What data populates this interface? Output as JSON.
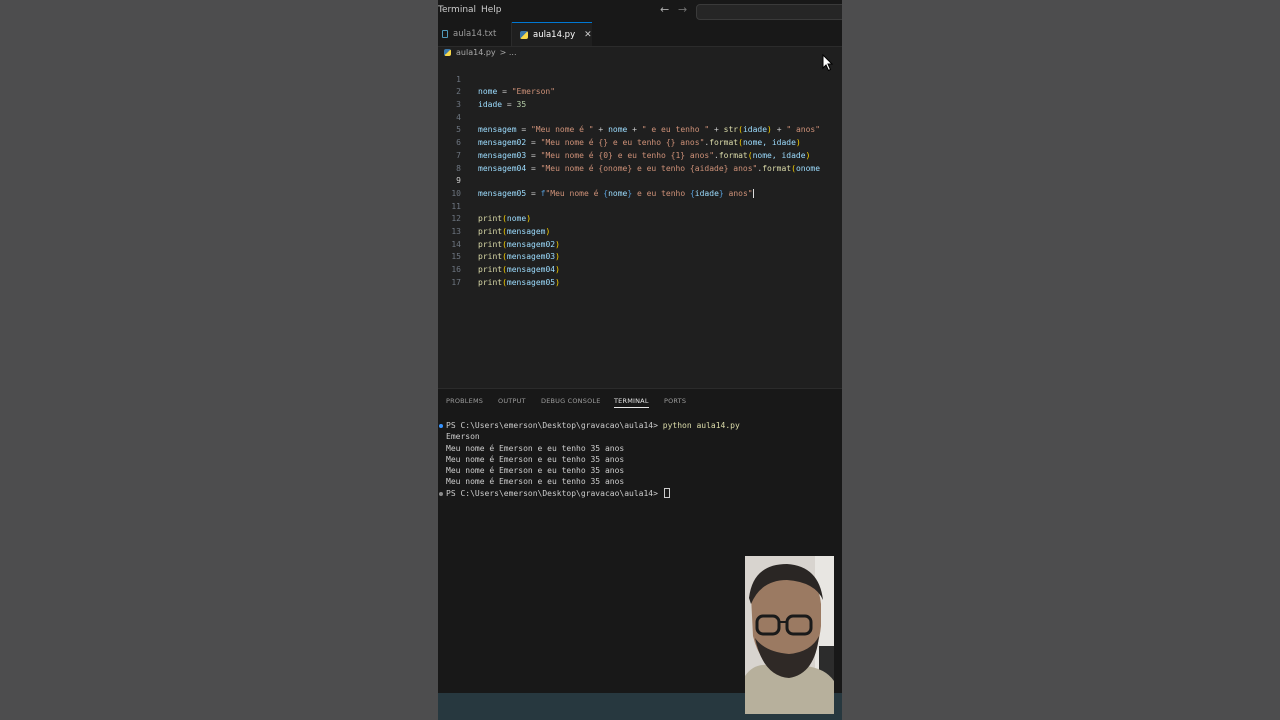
{
  "menu": {
    "terminal": "Terminal",
    "help": "Help"
  },
  "tabs": [
    {
      "label": "aula14.txt"
    },
    {
      "label": "aula14.py",
      "close": "✕"
    }
  ],
  "breadcrumb": {
    "file": "aula14.py",
    "sep": "> ..."
  },
  "editor": {
    "active_line": 9,
    "line_numbers": [
      "1",
      "2",
      "3",
      "4",
      "5",
      "6",
      "7",
      "8",
      "9",
      "10",
      "11",
      "12",
      "13",
      "14",
      "15",
      "16",
      "17"
    ],
    "lines": {
      "l1": {
        "var": "nome",
        "op": " = ",
        "str": "\"Emerson\""
      },
      "l2": {
        "var": "idade",
        "op": " = ",
        "num": "35"
      },
      "l4": {
        "var": "mensagem",
        "op": " = ",
        "s1": "\"Meu nome é \"",
        "p1": " + ",
        "v1": "nome",
        "p2": " + ",
        "s2": "\" e eu tenho \"",
        "p3": " + ",
        "fn": "str",
        "paren_open": "(",
        "v2": "idade",
        "paren_close": ")",
        "p4": " + ",
        "s3": "\" anos\""
      },
      "l5": {
        "var": "mensagem02",
        "op": " = ",
        "str": "\"Meu nome é {} e eu tenho {} anos\"",
        "dot": ".",
        "fn": "format",
        "paren_open": "(",
        "args": "nome, idade",
        "paren_close": ")"
      },
      "l6": {
        "var": "mensagem03",
        "op": " = ",
        "str": "\"Meu nome é {0} e eu tenho {1} anos\"",
        "dot": ".",
        "fn": "format",
        "paren_open": "(",
        "args": "nome, idade",
        "paren_close": ")"
      },
      "l7": {
        "var": "mensagem04",
        "op": " = ",
        "str": "\"Meu nome é {onome} e eu tenho {aidade} anos\"",
        "dot": ".",
        "fn": "format",
        "paren_open": "(",
        "args": "onome"
      },
      "l9": {
        "var": "mensagem05",
        "op": " = ",
        "prefix": "f",
        "s1": "\"Meu nome é ",
        "b1": "{",
        "v1": "nome",
        "b2": "}",
        "s2": " e eu tenho ",
        "b3": "{",
        "v2": "idade",
        "b4": "}",
        "s3": " anos\""
      },
      "l11": {
        "fn": "print",
        "arg": "nome"
      },
      "l12": {
        "fn": "print",
        "arg": "mensagem"
      },
      "l13": {
        "fn": "print",
        "arg": "mensagem02"
      },
      "l14": {
        "fn": "print",
        "arg": "mensagem03"
      },
      "l15": {
        "fn": "print",
        "arg": "mensagem04"
      },
      "l16": {
        "fn": "print",
        "arg": "mensagem05"
      }
    }
  },
  "panel": {
    "tabs": [
      "PROBLEMS",
      "OUTPUT",
      "DEBUG CONSOLE",
      "TERMINAL",
      "PORTS"
    ],
    "active_tab": "TERMINAL"
  },
  "terminal": {
    "prompt": "PS C:\\Users\\emerson\\Desktop\\gravacao\\aula14> ",
    "command": "python aula14.py",
    "output": [
      "Emerson",
      "Meu nome é Emerson e eu tenho 35 anos",
      "Meu nome é Emerson e eu tenho 35 anos",
      "Meu nome é Emerson e eu tenho 35 anos",
      "Meu nome é Emerson e eu tenho 35 anos"
    ],
    "prompt2": "PS C:\\Users\\emerson\\Desktop\\gravacao\\aula14> "
  },
  "colors": {
    "variable": "#9cdcfe",
    "string": "#ce9178",
    "number": "#b5cea8",
    "function": "#dcdcaa",
    "accent": "#0078d4"
  },
  "icons": {
    "python": "python-file-icon",
    "text": "text-file-icon"
  }
}
